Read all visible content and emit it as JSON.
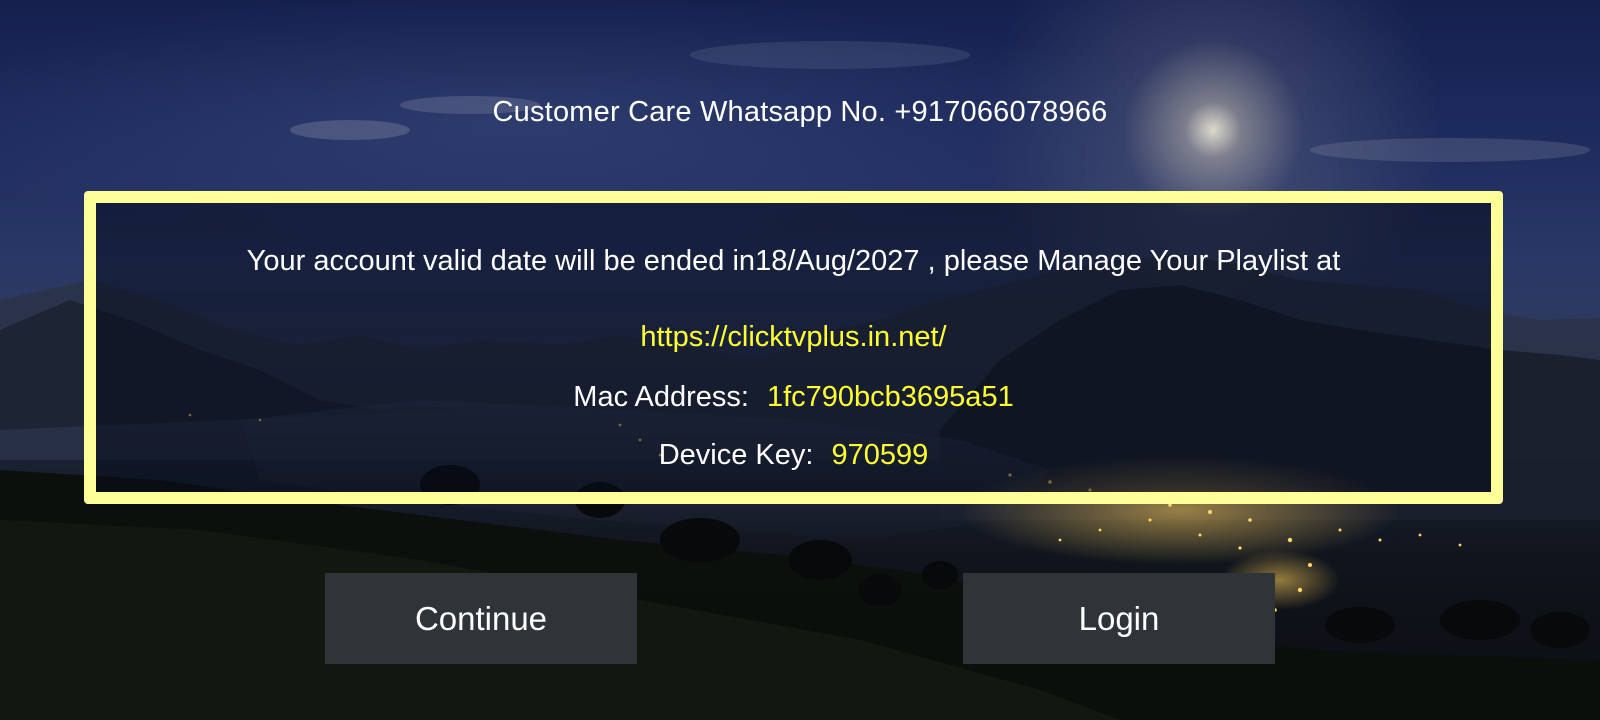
{
  "header": {
    "customer_care": "Customer Care Whatsapp No. +917066078966"
  },
  "notice": {
    "validity_text": "Your account valid date will be ended in18/Aug/2027 , please Manage Your Playlist at",
    "url": "https://clicktvplus.in.net/",
    "mac_label": "Mac Address:",
    "mac_value": "1fc790bcb3695a51",
    "device_key_label": "Device Key:",
    "device_key_value": "970599"
  },
  "buttons": {
    "continue_label": "Continue",
    "login_label": "Login"
  },
  "colors": {
    "box_border": "#ffff99",
    "highlight_text": "#ffff33",
    "button_bg": "#2f3438",
    "primary_text": "#ffffff"
  }
}
